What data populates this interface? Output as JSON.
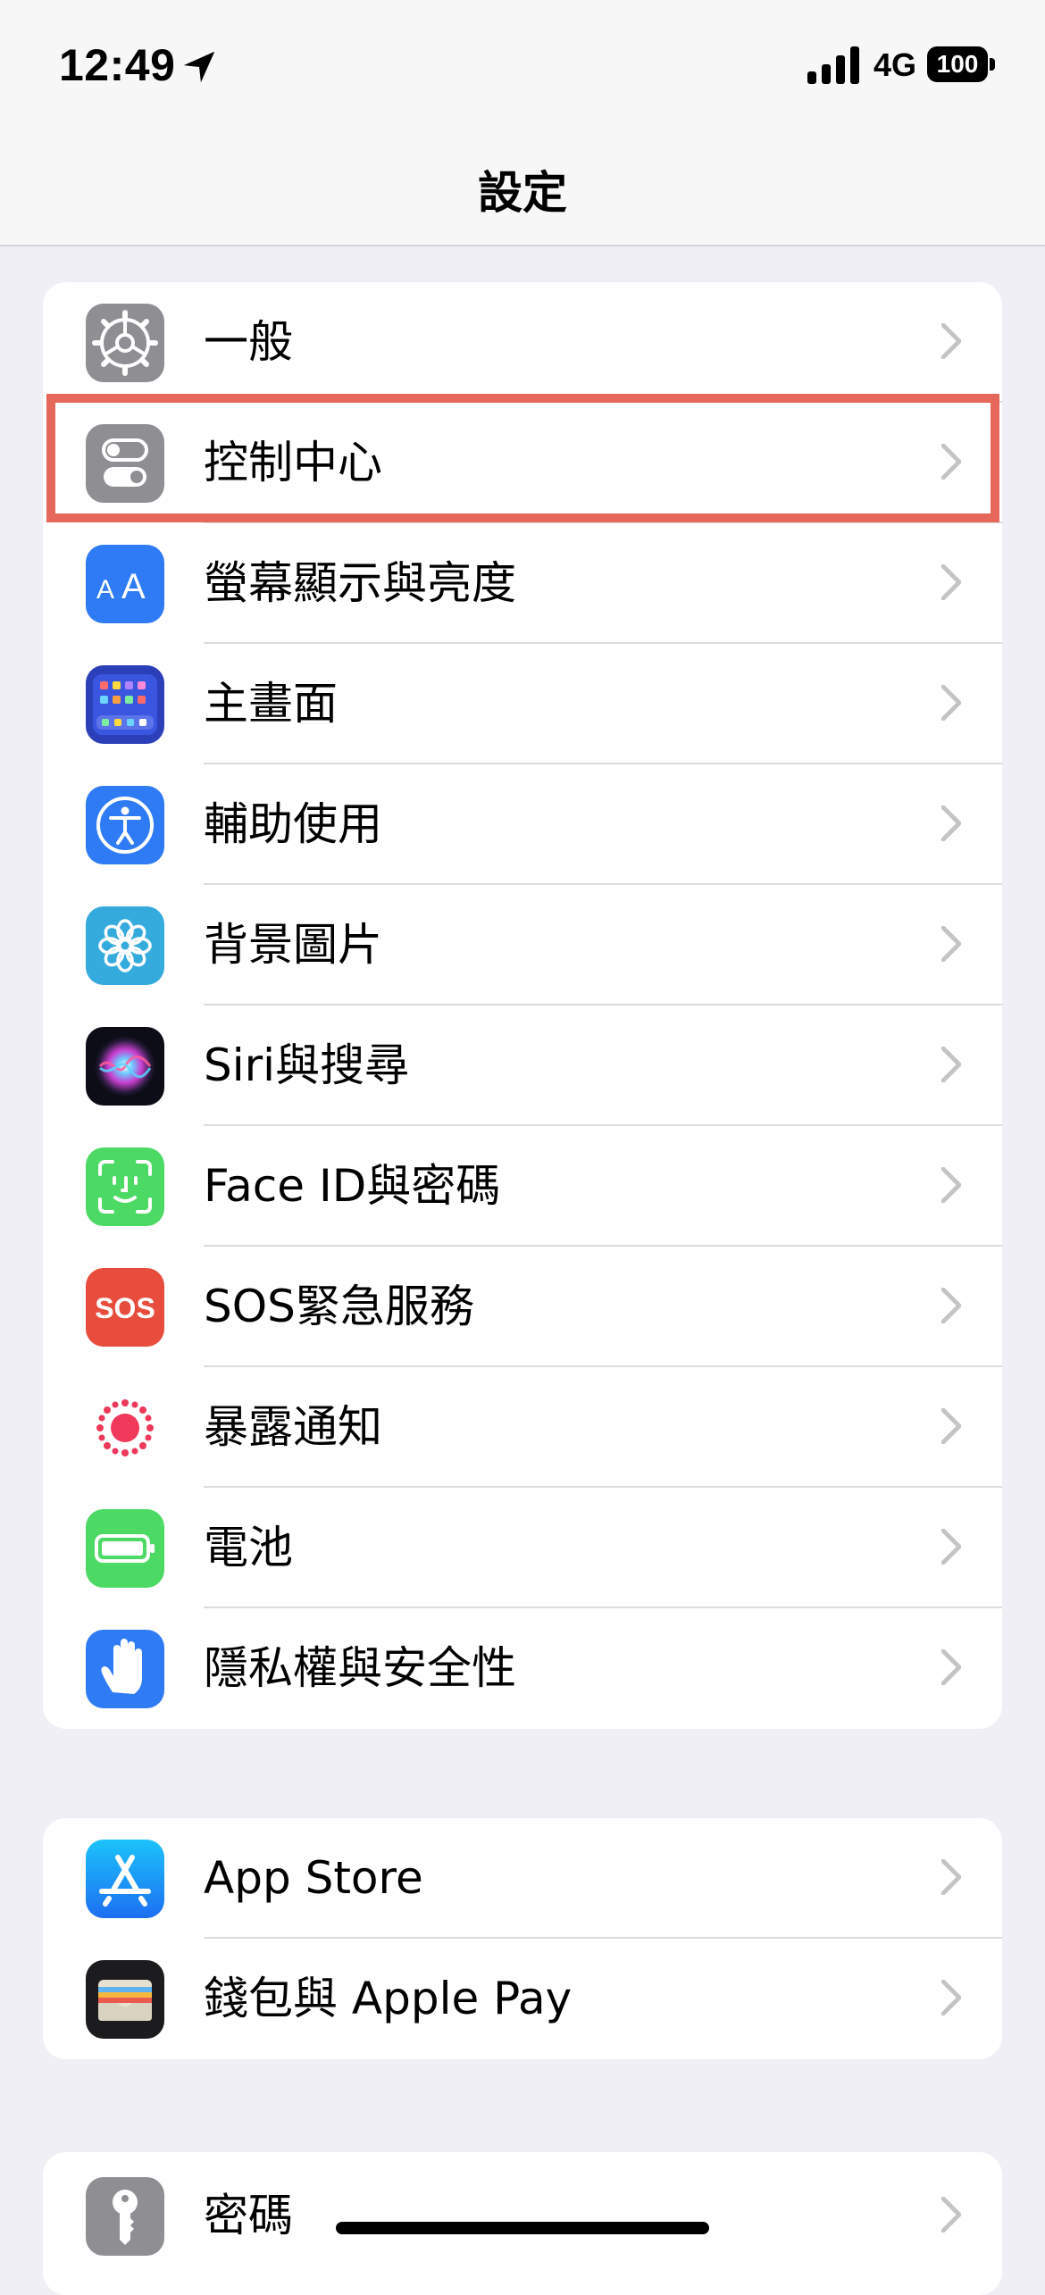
{
  "status_bar": {
    "time": "12:49",
    "network": "4G",
    "battery": "100"
  },
  "nav": {
    "title": "設定"
  },
  "groups": [
    {
      "rows": [
        {
          "label": "一般",
          "icon": "gear-icon",
          "color": "#8e8e93"
        },
        {
          "label": "控制中心",
          "icon": "toggles-icon",
          "color": "#8e8e93",
          "highlighted": true
        },
        {
          "label": "螢幕顯示與亮度",
          "icon": "text-size-icon",
          "color": "#2f7bf5"
        },
        {
          "label": "主畫面",
          "icon": "home-grid-icon",
          "color": "#3a4fd6"
        },
        {
          "label": "輔助使用",
          "icon": "accessibility-icon",
          "color": "#2f7bf5"
        },
        {
          "label": "背景圖片",
          "icon": "flower-icon",
          "color": "#35aadc"
        },
        {
          "label": "Siri與搜尋",
          "icon": "siri-icon",
          "color": "#1c1c2e"
        },
        {
          "label": "Face ID與密碼",
          "icon": "face-id-icon",
          "color": "#4cd964"
        },
        {
          "label": "SOS緊急服務",
          "icon": "sos-icon",
          "color": "#e74c3c"
        },
        {
          "label": "暴露通知",
          "icon": "exposure-icon",
          "color": "#ffffff"
        },
        {
          "label": "電池",
          "icon": "battery-icon",
          "color": "#4cd964"
        },
        {
          "label": "隱私權與安全性",
          "icon": "hand-icon",
          "color": "#2f7bf5"
        }
      ]
    },
    {
      "rows": [
        {
          "label": "App Store",
          "icon": "app-store-icon",
          "color": "#1f8ef1"
        },
        {
          "label": "錢包與 Apple Pay",
          "icon": "wallet-icon",
          "color": "#1c1c1e"
        }
      ]
    },
    {
      "rows": [
        {
          "label": "密碼",
          "icon": "key-icon",
          "color": "#8e8e93"
        }
      ]
    }
  ],
  "sos_text": "SOS",
  "highlight_color": "#e6685a"
}
